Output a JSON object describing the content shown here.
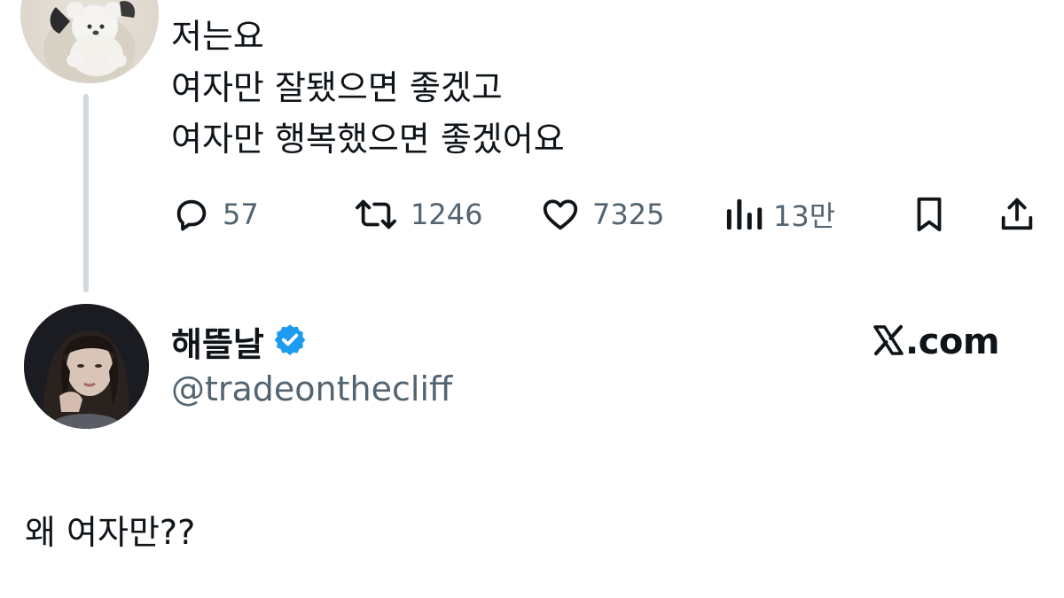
{
  "tweet": {
    "lines": [
      "저는요",
      "여자만 잘됐으면 좋겠고",
      "여자만 행복했으면 좋겠어요"
    ],
    "actions": {
      "replies": "57",
      "retweets": "1246",
      "likes": "7325",
      "views": "13만"
    },
    "avatar_icon": "plush-toy-avatar"
  },
  "author": {
    "name": "해뜰날",
    "handle": "@tradeonthecliff",
    "verified": true,
    "avatar_icon": "profile-photo-avatar"
  },
  "branding": {
    "site": ".com",
    "logo_icon": "x-logo-icon"
  },
  "reply": {
    "text": "왜 여자만??"
  },
  "colors": {
    "text": "#0f1419",
    "secondary": "#536471",
    "verified": "#1d9bf0",
    "thread_line": "#cfd9de"
  }
}
